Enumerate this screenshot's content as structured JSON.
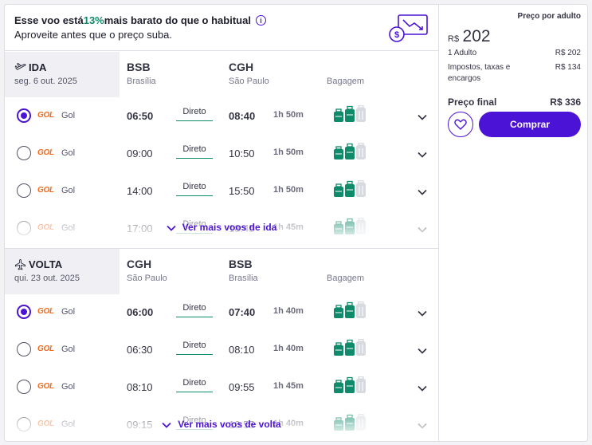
{
  "banner": {
    "text_before": "Esse voo está ",
    "highlight": "13%",
    "text_after": " mais barato do que o habitual",
    "subtitle": "Aproveite antes que o preço suba.",
    "info_icon": "i"
  },
  "outbound": {
    "label": "IDA",
    "date": "seg. 6 out. 2025",
    "origin_code": "BSB",
    "origin_city": "Brasília",
    "dest_code": "CGH",
    "dest_city": "São Paulo",
    "baggage_label": "Bagagem",
    "flights": [
      {
        "logo": "GOL",
        "airline": "Gol",
        "dep": "06:50",
        "stops": "Direto",
        "arr": "08:40",
        "duration": "1h 50m",
        "selected": true
      },
      {
        "logo": "GOL",
        "airline": "Gol",
        "dep": "09:00",
        "stops": "Direto",
        "arr": "10:50",
        "duration": "1h 50m",
        "selected": false
      },
      {
        "logo": "GOL",
        "airline": "Gol",
        "dep": "14:00",
        "stops": "Direto",
        "arr": "15:50",
        "duration": "1h 50m",
        "selected": false
      },
      {
        "logo": "GOL",
        "airline": "Gol",
        "dep": "17:00",
        "stops": "Direto",
        "arr": "18:45",
        "duration": "1h 45m",
        "selected": false
      }
    ],
    "see_more": "Ver mais voos de ida"
  },
  "return": {
    "label": "VOLTA",
    "date": "qui. 23 out. 2025",
    "origin_code": "CGH",
    "origin_city": "São Paulo",
    "dest_code": "BSB",
    "dest_city": "Brasília",
    "baggage_label": "Bagagem",
    "flights": [
      {
        "logo": "GOL",
        "airline": "Gol",
        "dep": "06:00",
        "stops": "Direto",
        "arr": "07:40",
        "duration": "1h 40m",
        "selected": true
      },
      {
        "logo": "GOL",
        "airline": "Gol",
        "dep": "06:30",
        "stops": "Direto",
        "arr": "08:10",
        "duration": "1h 40m",
        "selected": false
      },
      {
        "logo": "GOL",
        "airline": "Gol",
        "dep": "08:10",
        "stops": "Direto",
        "arr": "09:55",
        "duration": "1h 45m",
        "selected": false
      },
      {
        "logo": "GOL",
        "airline": "Gol",
        "dep": "09:15",
        "stops": "Direto",
        "arr": "10:55",
        "duration": "1h 40m",
        "selected": false
      }
    ],
    "see_more": "Ver mais voos de volta"
  },
  "pricing": {
    "header": "Preço por adulto",
    "currency": "R$",
    "per_adult": "202",
    "adult_label": "1 Adulto",
    "adult_value": "R$ 202",
    "taxes_label_1": "Impostos, taxas e",
    "taxes_label_2": "encargos",
    "taxes_value": "R$ 134",
    "final_label": "Preço final",
    "final_value": "R$ 336",
    "buy_label": "Comprar"
  },
  "colors": {
    "accent": "#4b13d6",
    "positive": "#0f8a6a",
    "airline_logo": "#f26a1b"
  }
}
